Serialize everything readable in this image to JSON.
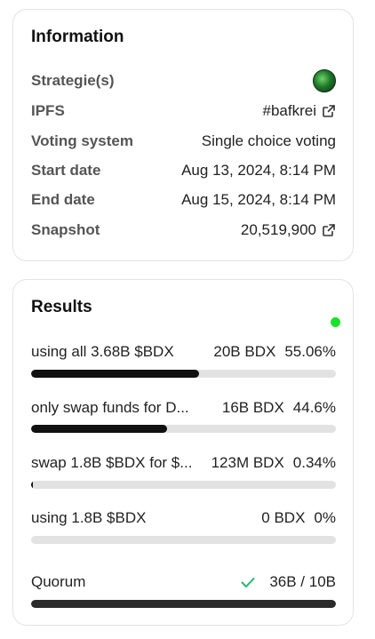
{
  "information": {
    "title": "Information",
    "rows": [
      {
        "label": "Strategie(s)",
        "value": "",
        "icon": "strategy-avatar-icon"
      },
      {
        "label": "IPFS",
        "value": "#bafkrei",
        "icon": "external-link-icon"
      },
      {
        "label": "Voting system",
        "value": "Single choice voting"
      },
      {
        "label": "Start date",
        "value": "Aug 13, 2024, 8:14 PM"
      },
      {
        "label": "End date",
        "value": "Aug 15, 2024, 8:14 PM"
      },
      {
        "label": "Snapshot",
        "value": "20,519,900",
        "icon": "external-link-icon"
      }
    ]
  },
  "results": {
    "title": "Results",
    "status_color": "#18e22a",
    "choices": [
      {
        "label": "using all 3.68B $BDX",
        "amount": "20B BDX",
        "percent": "55.06%",
        "fraction": 0.5506
      },
      {
        "label": "only swap funds for D...",
        "amount": "16B BDX",
        "percent": "44.6%",
        "fraction": 0.446
      },
      {
        "label": "swap 1.8B $BDX for $...",
        "amount": "123M BDX",
        "percent": "0.34%",
        "fraction": 0.0034
      },
      {
        "label": "using 1.8B $BDX",
        "amount": "0 BDX",
        "percent": "0%",
        "fraction": 0
      }
    ],
    "quorum": {
      "label": "Quorum",
      "value": "36B / 10B",
      "fraction": 1,
      "check_color": "#21b66f"
    }
  }
}
